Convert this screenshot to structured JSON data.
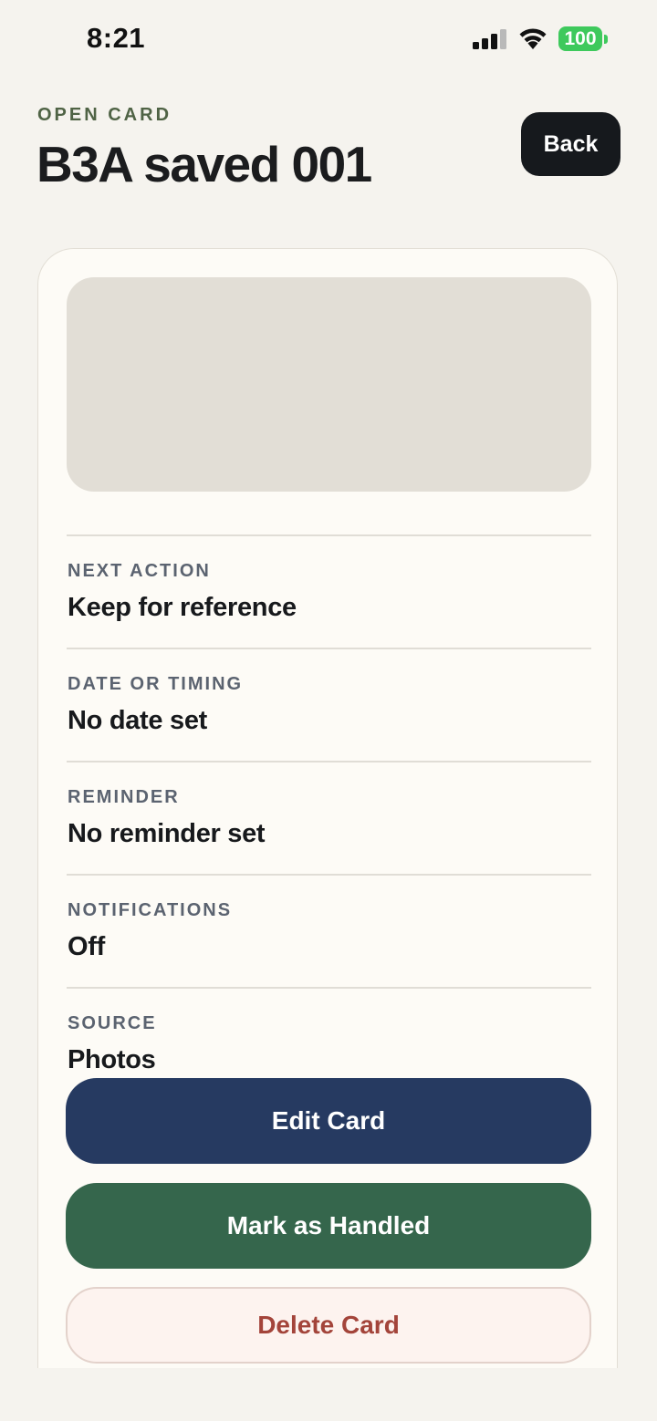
{
  "status_bar": {
    "time": "8:21",
    "battery": "100",
    "signal_icon": "cellular-signal-icon",
    "wifi_icon": "wifi-icon",
    "battery_color": "#3ec95c"
  },
  "header": {
    "eyebrow": "OPEN CARD",
    "title": "B3A saved 001",
    "back_label": "Back"
  },
  "card": {
    "fields": [
      {
        "label": "NEXT ACTION",
        "value": "Keep for reference"
      },
      {
        "label": "DATE OR TIMING",
        "value": "No date set"
      },
      {
        "label": "REMINDER",
        "value": "No reminder set"
      },
      {
        "label": "NOTIFICATIONS",
        "value": "Off"
      },
      {
        "label": "SOURCE",
        "value": "Photos"
      }
    ]
  },
  "actions": {
    "edit_label": "Edit Card",
    "handled_label": "Mark as Handled",
    "delete_label": "Delete Card"
  },
  "colors": {
    "background": "#f5f3ee",
    "eyebrow": "#4f6345",
    "edit_button": "#263a61",
    "handled_button": "#35664c",
    "delete_text": "#a3443a"
  }
}
